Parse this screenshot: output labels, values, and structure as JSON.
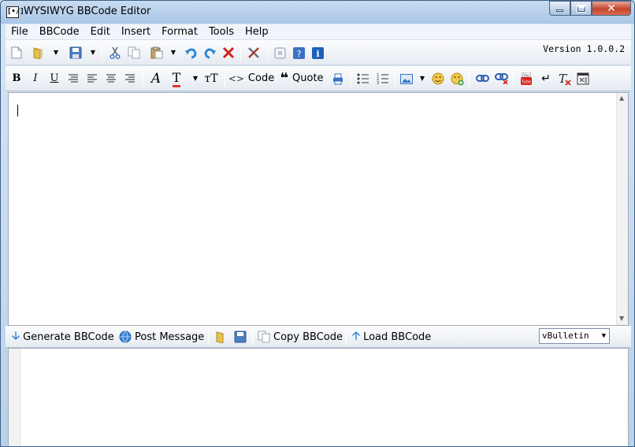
{
  "window": {
    "title": "WYSIWYG BBCode Editor",
    "app_icon": "[•/]"
  },
  "menu": [
    "File",
    "BBCode",
    "Edit",
    "Insert",
    "Format",
    "Tools",
    "Help"
  ],
  "toolbar1": {
    "icons": [
      "new-document-icon",
      "open-folder-icon",
      "save-icon",
      "cut-icon",
      "copy-icon",
      "paste-icon",
      "undo-icon",
      "redo-icon",
      "delete-icon",
      "tools-icon",
      "preview-icon",
      "help-icon",
      "info-icon"
    ],
    "version": "Version 1.0.0.2"
  },
  "toolbar2": {
    "bold": "B",
    "italic": "I",
    "underline": "U",
    "font": "A",
    "text_color": "T",
    "font_size": "тT",
    "code_label": "Code",
    "quote_label": "Quote"
  },
  "bottombar": {
    "generate": "Generate BBCode",
    "post": "Post Message",
    "copy": "Copy BBCode",
    "load": "Load BBCode",
    "forum_selected": "vBulletin"
  },
  "colors": {
    "accent": "#1f6fd0",
    "close": "#c5452b"
  }
}
